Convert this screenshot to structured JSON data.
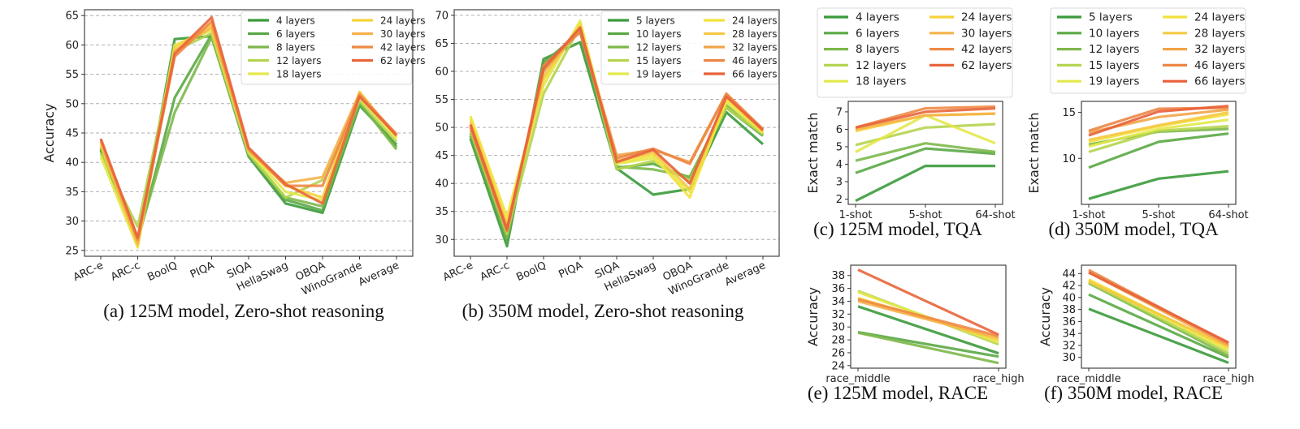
{
  "chart_data": [
    {
      "id": "a",
      "type": "line",
      "caption": "(a) 125M model, Zero-shot reasoning",
      "title": "",
      "xlabel": "",
      "ylabel": "Accuracy",
      "categories": [
        "ARC-e",
        "ARC-c",
        "BoolQ",
        "PIQA",
        "SIQA",
        "HellaSwag",
        "OBQA",
        "WinoGrande",
        "Average"
      ],
      "ylim": [
        24,
        66
      ],
      "yticks": [
        25,
        30,
        35,
        40,
        45,
        50,
        55,
        60,
        65
      ],
      "grid": "y-dashed",
      "legend_position": "top-right",
      "legend_columns": 2,
      "series": [
        {
          "name": "4 layers",
          "color": "#3b9a3b",
          "values": [
            42.2,
            26.0,
            61.0,
            61.5,
            41.0,
            33.0,
            31.4,
            49.7,
            43.0
          ]
        },
        {
          "name": "6 layers",
          "color": "#5aa845",
          "values": [
            42.0,
            26.5,
            51.0,
            61.8,
            41.2,
            33.6,
            31.8,
            50.0,
            42.6
          ]
        },
        {
          "name": "8 layers",
          "color": "#7db84a",
          "values": [
            42.5,
            27.0,
            48.5,
            61.3,
            41.3,
            34.0,
            32.5,
            50.2,
            42.2
          ]
        },
        {
          "name": "12 layers",
          "color": "#b5d450",
          "values": [
            41.5,
            29.0,
            59.0,
            62.0,
            41.5,
            34.0,
            37.0,
            50.5,
            43.5
          ]
        },
        {
          "name": "18 layers",
          "color": "#e3e84a",
          "values": [
            41.0,
            25.5,
            60.0,
            62.5,
            41.8,
            35.0,
            33.5,
            51.0,
            44.0
          ]
        },
        {
          "name": "24 layers",
          "color": "#f6d23a",
          "values": [
            43.0,
            25.8,
            59.5,
            63.5,
            42.0,
            36.0,
            34.0,
            52.0,
            44.3
          ]
        },
        {
          "name": "30 layers",
          "color": "#f5b24a",
          "values": [
            43.5,
            26.2,
            59.0,
            63.0,
            42.0,
            36.5,
            37.5,
            51.8,
            44.5
          ]
        },
        {
          "name": "42 layers",
          "color": "#ef8a45",
          "values": [
            44.0,
            26.8,
            58.0,
            64.0,
            42.3,
            36.0,
            36.0,
            51.5,
            44.8
          ]
        },
        {
          "name": "62 layers",
          "color": "#e8653a",
          "values": [
            44.0,
            27.2,
            58.5,
            64.7,
            42.5,
            36.3,
            33.0,
            51.2,
            44.6
          ]
        }
      ]
    },
    {
      "id": "b",
      "type": "line",
      "caption": "(b) 350M model, Zero-shot reasoning",
      "title": "",
      "xlabel": "",
      "ylabel": "",
      "categories": [
        "ARC-e",
        "ARC-c",
        "BoolQ",
        "PIQA",
        "SIQA",
        "HellaSwag",
        "OBQA",
        "WinoGrande",
        "Average"
      ],
      "ylim": [
        27,
        71
      ],
      "yticks": [
        30,
        35,
        40,
        45,
        50,
        55,
        60,
        65,
        70
      ],
      "grid": "y-dashed",
      "legend_position": "top-right",
      "legend_columns": 2,
      "series": [
        {
          "name": "5 layers",
          "color": "#3b9a3b",
          "values": [
            48.0,
            28.8,
            62.2,
            65.2,
            42.7,
            38.0,
            39.0,
            52.7,
            47.0
          ]
        },
        {
          "name": "10 layers",
          "color": "#5aa845",
          "values": [
            48.5,
            29.8,
            61.5,
            67.0,
            42.8,
            43.5,
            41.0,
            53.5,
            48.5
          ]
        },
        {
          "name": "12 layers",
          "color": "#7db84a",
          "values": [
            49.0,
            30.5,
            60.0,
            67.5,
            43.0,
            42.5,
            41.2,
            54.0,
            48.7
          ]
        },
        {
          "name": "15 layers",
          "color": "#b5d450",
          "values": [
            49.5,
            31.0,
            56.0,
            68.0,
            42.5,
            44.0,
            40.5,
            53.5,
            48.8
          ]
        },
        {
          "name": "19 layers",
          "color": "#e3e84a",
          "values": [
            51.5,
            33.0,
            57.5,
            69.0,
            43.5,
            44.5,
            38.5,
            54.5,
            49.0
          ]
        },
        {
          "name": "24 layers",
          "color": "#f2e23c",
          "values": [
            52.0,
            34.0,
            58.5,
            68.5,
            43.8,
            45.0,
            37.5,
            55.0,
            49.2
          ]
        },
        {
          "name": "28 layers",
          "color": "#f6c844",
          "values": [
            51.0,
            32.5,
            59.0,
            68.0,
            44.0,
            45.5,
            39.0,
            55.5,
            49.3
          ]
        },
        {
          "name": "32 layers",
          "color": "#f2a448",
          "values": [
            50.5,
            32.0,
            60.0,
            67.5,
            45.0,
            46.0,
            43.8,
            56.0,
            49.5
          ]
        },
        {
          "name": "46 layers",
          "color": "#ec8645",
          "values": [
            50.0,
            31.5,
            61.0,
            67.0,
            44.5,
            46.2,
            43.5,
            56.0,
            49.7
          ]
        },
        {
          "name": "66 layers",
          "color": "#e8603a",
          "values": [
            50.5,
            31.8,
            60.5,
            67.8,
            43.8,
            46.0,
            40.0,
            55.5,
            49.5
          ]
        }
      ]
    },
    {
      "id": "c",
      "type": "line",
      "caption": "(c) 125M model, TQA",
      "title": "",
      "xlabel": "",
      "ylabel": "Exact match",
      "categories": [
        "1-shot",
        "5-shot",
        "64-shot"
      ],
      "ylim": [
        1.7,
        7.6
      ],
      "yticks": [
        2,
        3,
        4,
        5,
        6,
        7
      ],
      "grid": "none",
      "legend_position": "above",
      "legend_columns": 2,
      "series": [
        {
          "name": "4 layers",
          "color": "#3b9a3b",
          "values": [
            1.9,
            3.9,
            3.9
          ]
        },
        {
          "name": "6 layers",
          "color": "#5aa845",
          "values": [
            3.5,
            4.9,
            4.6
          ]
        },
        {
          "name": "8 layers",
          "color": "#7db84a",
          "values": [
            4.2,
            5.2,
            4.7
          ]
        },
        {
          "name": "12 layers",
          "color": "#b5d450",
          "values": [
            5.1,
            6.1,
            6.3
          ]
        },
        {
          "name": "18 layers",
          "color": "#e3e84a",
          "values": [
            4.7,
            6.8,
            5.2
          ]
        },
        {
          "name": "24 layers",
          "color": "#f6d23a",
          "values": [
            5.9,
            6.8,
            6.9
          ]
        },
        {
          "name": "30 layers",
          "color": "#f5b24a",
          "values": [
            6.0,
            6.8,
            6.9
          ]
        },
        {
          "name": "42 layers",
          "color": "#ef8a45",
          "values": [
            6.1,
            7.2,
            7.3
          ]
        },
        {
          "name": "62 layers",
          "color": "#e8653a",
          "values": [
            6.1,
            7.0,
            7.2
          ]
        }
      ]
    },
    {
      "id": "d",
      "type": "line",
      "caption": "(d) 350M model, TQA",
      "title": "",
      "xlabel": "",
      "ylabel": "Exact match",
      "categories": [
        "1-shot",
        "5-shot",
        "64-shot"
      ],
      "ylim": [
        5.0,
        16.2
      ],
      "yticks": [
        10,
        15
      ],
      "grid": "none",
      "legend_position": "above",
      "legend_columns": 2,
      "series": [
        {
          "name": "5 layers",
          "color": "#3b9a3b",
          "values": [
            5.6,
            7.8,
            8.6
          ]
        },
        {
          "name": "10 layers",
          "color": "#5aa845",
          "values": [
            9.0,
            11.8,
            12.7
          ]
        },
        {
          "name": "12 layers",
          "color": "#7db84a",
          "values": [
            11.5,
            12.9,
            13.2
          ]
        },
        {
          "name": "15 layers",
          "color": "#b5d450",
          "values": [
            10.7,
            13.0,
            13.5
          ]
        },
        {
          "name": "19 layers",
          "color": "#e3e84a",
          "values": [
            11.3,
            13.2,
            14.2
          ]
        },
        {
          "name": "24 layers",
          "color": "#f2e23c",
          "values": [
            11.8,
            13.5,
            14.8
          ]
        },
        {
          "name": "28 layers",
          "color": "#f6c844",
          "values": [
            12.0,
            13.6,
            15.0
          ]
        },
        {
          "name": "32 layers",
          "color": "#f2a448",
          "values": [
            12.8,
            14.5,
            15.3
          ]
        },
        {
          "name": "46 layers",
          "color": "#ec8645",
          "values": [
            13.0,
            15.4,
            15.5
          ]
        },
        {
          "name": "66 layers",
          "color": "#e8603a",
          "values": [
            12.5,
            15.1,
            15.7
          ]
        }
      ]
    },
    {
      "id": "e",
      "type": "line",
      "caption": "(e) 125M model, RACE",
      "title": "",
      "xlabel": "",
      "ylabel": "Accuracy",
      "categories": [
        "race_middle",
        "race_high"
      ],
      "ylim": [
        23.6,
        39.6
      ],
      "yticks": [
        24,
        26,
        28,
        30,
        32,
        34,
        36,
        38
      ],
      "grid": "none",
      "series": [
        {
          "name": "4 layers",
          "color": "#3b9a3b",
          "values": [
            33.2,
            25.9
          ]
        },
        {
          "name": "6 layers",
          "color": "#5aa845",
          "values": [
            29.2,
            25.4
          ]
        },
        {
          "name": "8 layers",
          "color": "#7db84a",
          "values": [
            29.1,
            24.4
          ]
        },
        {
          "name": "12 layers",
          "color": "#b5d450",
          "values": [
            35.6,
            27.3
          ]
        },
        {
          "name": "18 layers",
          "color": "#e3e84a",
          "values": [
            35.4,
            27.6
          ]
        },
        {
          "name": "24 layers",
          "color": "#f6d23a",
          "values": [
            34.5,
            28.0
          ]
        },
        {
          "name": "30 layers",
          "color": "#f5b24a",
          "values": [
            34.0,
            28.3
          ]
        },
        {
          "name": "42 layers",
          "color": "#ef8a45",
          "values": [
            34.3,
            28.6
          ]
        },
        {
          "name": "62 layers",
          "color": "#e8653a",
          "values": [
            38.9,
            28.8
          ]
        }
      ]
    },
    {
      "id": "f",
      "type": "line",
      "caption": "(f) 350M model, RACE",
      "title": "",
      "xlabel": "",
      "ylabel": "Accuracy",
      "categories": [
        "race_middle",
        "race_high"
      ],
      "ylim": [
        28.2,
        45.4
      ],
      "yticks": [
        30,
        32,
        34,
        36,
        38,
        40,
        42,
        44
      ],
      "grid": "none",
      "series": [
        {
          "name": "5 layers",
          "color": "#3b9a3b",
          "values": [
            38.1,
            29.1
          ]
        },
        {
          "name": "10 layers",
          "color": "#5aa845",
          "values": [
            40.5,
            30.0
          ]
        },
        {
          "name": "12 layers",
          "color": "#7db84a",
          "values": [
            42.4,
            30.3
          ]
        },
        {
          "name": "15 layers",
          "color": "#b5d450",
          "values": [
            42.6,
            30.7
          ]
        },
        {
          "name": "19 layers",
          "color": "#e3e84a",
          "values": [
            42.8,
            31.2
          ]
        },
        {
          "name": "24 layers",
          "color": "#f2e23c",
          "values": [
            43.0,
            31.5
          ]
        },
        {
          "name": "28 layers",
          "color": "#f6c844",
          "values": [
            42.7,
            31.8
          ]
        },
        {
          "name": "32 layers",
          "color": "#f2a448",
          "values": [
            44.2,
            32.0
          ]
        },
        {
          "name": "46 layers",
          "color": "#ec8645",
          "values": [
            44.6,
            32.3
          ]
        },
        {
          "name": "66 layers",
          "color": "#e8603a",
          "values": [
            44.2,
            32.5
          ]
        }
      ]
    }
  ]
}
